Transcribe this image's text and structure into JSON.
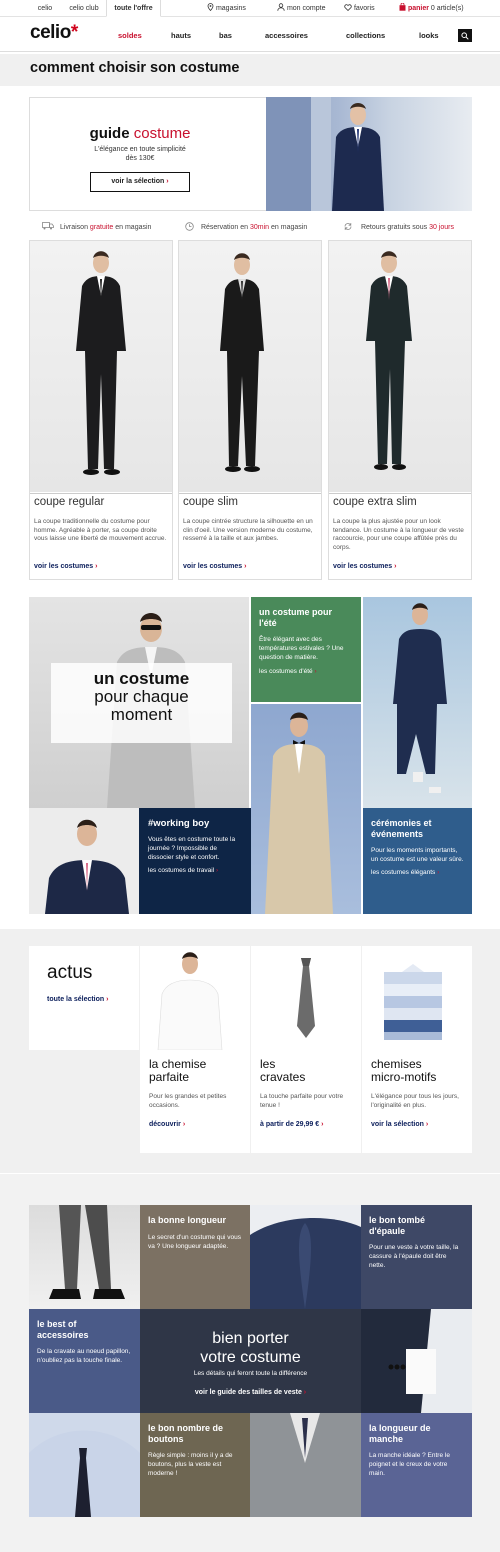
{
  "topbar": {
    "tabs": [
      "celio",
      "celio club",
      "toute l'offre"
    ],
    "links": {
      "stores": "magasins",
      "account": "mon compte",
      "favorites": "favoris",
      "cart_label": "panier",
      "cart_count": "0 article(s)"
    }
  },
  "nav": {
    "logo": "celio",
    "items": [
      "soldes",
      "hauts",
      "bas",
      "accessoires",
      "collections",
      "looks"
    ]
  },
  "page": {
    "title": "comment choisir son costume"
  },
  "hero": {
    "title_a": "guide",
    "title_b": "costume",
    "sub1": "L'élégance en toute simplicité",
    "sub2": "dès 130€",
    "button": "voir la sélection"
  },
  "services": [
    {
      "pre": "Livraison",
      "red": "gratuite",
      "post": "en magasin"
    },
    {
      "pre": "Réservation en",
      "red": "30min",
      "post": "en magasin"
    },
    {
      "pre": "Retours gratuits sous",
      "red": "30 jours",
      "post": ""
    }
  ],
  "cuts": [
    {
      "title": "coupe regular",
      "desc": "La coupe traditionnelle du costume pour homme. Agréable à porter, sa coupe droite vous laisse une liberté de mouvement accrue.",
      "link": "voir les costumes"
    },
    {
      "title": "coupe slim",
      "desc": "La coupe cintrée structure la silhouette en un clin d'oeil. Une version moderne du costume, resserré à la taille et aux jambes.",
      "link": "voir les costumes"
    },
    {
      "title": "coupe extra slim",
      "desc": "La coupe la plus ajustée pour un look tendance. Un costume à la longueur de veste raccourcie, pour une coupe affûtée près du corps.",
      "link": "voir les costumes"
    }
  ],
  "moment": {
    "headline1": "un costume",
    "headline2": "pour chaque",
    "headline3": "moment",
    "summer_title1": "un costume pour",
    "summer_title2": "l'été",
    "summer_text": "Être élégant avec des températures estivales ? Une question de matière.",
    "summer_link": "les costumes d'été",
    "work_title": "#working boy",
    "work_text": "Vous êtes en costume toute la journée ? Impossible de dissocier style et confort.",
    "work_link": "les costumes de travail",
    "cer_title1": "cérémonies et",
    "cer_title2": "événements",
    "cer_text": "Pour les moments importants, un costume est une valeur sûre.",
    "cer_link": "les costumes élégants"
  },
  "actus": {
    "title": "actus",
    "link": "toute la sélection",
    "items": [
      {
        "title1": "la chemise",
        "title2": "parfaite",
        "desc": "Pour les grandes et petites occasions.",
        "link": "découvrir"
      },
      {
        "title1": "les",
        "title2": "cravates",
        "desc": "La touche parfaite pour votre tenue !",
        "link": "à partir de 29,99 €"
      },
      {
        "title1": "chemises",
        "title2": "micro-motifs",
        "desc": "L'élégance pour tous les jours, l'originalité en plus.",
        "link": "voir la sélection"
      }
    ]
  },
  "bienporter": {
    "title1": "bien porter",
    "title2": "votre costume",
    "sub": "Les détails qui feront toute la différence",
    "link": "voir le guide des tailles de veste",
    "length_title": "la bonne longueur",
    "length_text": "Le secret d'un costume qui vous va ? Une longueur adaptée.",
    "shoulder_title1": "le bon tombé",
    "shoulder_title2": "d'épaule",
    "shoulder_text": "Pour une veste à votre taille, la cassure à l'épaule doit être nette.",
    "acc_title1": "le best of",
    "acc_title2": "accessoires",
    "acc_text": "De la cravate au noeud papillon, n'oubliez pas la touche finale.",
    "buttons_title1": "le bon nombre de",
    "buttons_title2": "boutons",
    "buttons_text": "Règle simple : moins il y a de boutons, plus la veste est moderne !",
    "sleeve_title1": "la longueur de",
    "sleeve_title2": "manche",
    "sleeve_text": "La manche idéale ? Entre le poignet et le creux de votre main."
  },
  "colors": {
    "brand_red": "#c8102e",
    "navy": "#0b1e5b",
    "green": "#4a8a5a",
    "slate": "#3a4562",
    "taupe": "#7c7163"
  }
}
